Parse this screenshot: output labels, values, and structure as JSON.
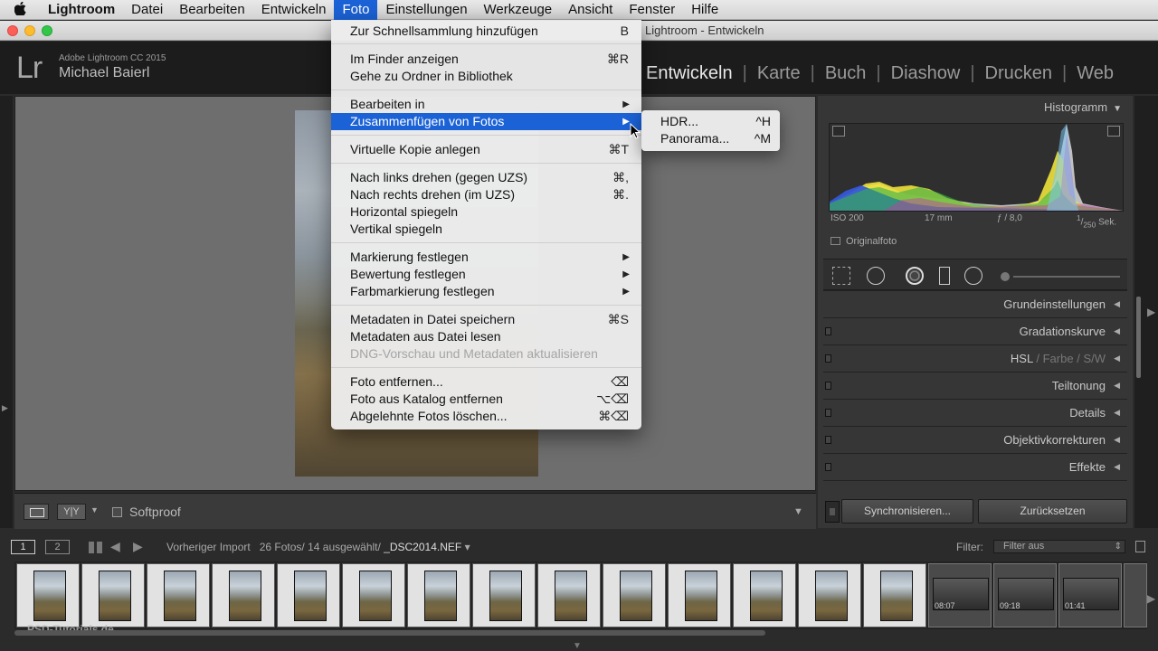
{
  "menubar": {
    "apple": "",
    "items": [
      "Lightroom",
      "Datei",
      "Bearbeiten",
      "Entwickeln",
      "Foto",
      "Einstellungen",
      "Werkzeuge",
      "Ansicht",
      "Fenster",
      "Hilfe"
    ],
    "active": "Foto"
  },
  "window": {
    "title": "Lightroom - Entwickeln"
  },
  "identity": {
    "logo": "Lr",
    "product": "Adobe Lightroom CC 2015",
    "user": "Michael Baierl"
  },
  "modules": {
    "items": [
      "Entwickeln",
      "Karte",
      "Buch",
      "Diashow",
      "Drucken",
      "Web"
    ],
    "active": "Entwickeln"
  },
  "foto_menu": {
    "items": [
      {
        "label": "Zur Schnellsammlung hinzufügen",
        "shortcut": "B"
      },
      {
        "label": "Im Finder anzeigen",
        "shortcut": "⌘R"
      },
      {
        "label": "Gehe zu Ordner in Bibliothek",
        "shortcut": ""
      },
      {
        "label": "Bearbeiten in",
        "submenu": "▶"
      },
      {
        "label": "Zusammenfügen von Fotos",
        "submenu": "▶"
      },
      {
        "label": "Virtuelle Kopie anlegen",
        "shortcut": "⌘T"
      },
      {
        "label": "Nach links drehen (gegen UZS)",
        "shortcut": "⌘,"
      },
      {
        "label": "Nach rechts drehen (im UZS)",
        "shortcut": "⌘."
      },
      {
        "label": "Horizontal spiegeln",
        "shortcut": ""
      },
      {
        "label": "Vertikal spiegeln",
        "shortcut": ""
      },
      {
        "label": "Markierung festlegen",
        "submenu": "▶"
      },
      {
        "label": "Bewertung festlegen",
        "submenu": "▶"
      },
      {
        "label": "Farbmarkierung festlegen",
        "submenu": "▶"
      },
      {
        "label": "Metadaten in Datei speichern",
        "shortcut": "⌘S"
      },
      {
        "label": "Metadaten aus Datei lesen",
        "shortcut": ""
      },
      {
        "label": "DNG-Vorschau und Metadaten aktualisieren",
        "shortcut": ""
      },
      {
        "label": "Foto entfernen...",
        "shortcut": "⌫"
      },
      {
        "label": "Foto aus Katalog entfernen",
        "shortcut": "⌥⌫"
      },
      {
        "label": "Abgelehnte Fotos löschen...",
        "shortcut": "⌘⌫"
      }
    ]
  },
  "merge_submenu": {
    "items": [
      {
        "label": "HDR...",
        "shortcut": "^H"
      },
      {
        "label": "Panorama...",
        "shortcut": "^M"
      }
    ]
  },
  "histogram": {
    "title": "Histogramm",
    "toggle": "▼",
    "iso": "ISO 200",
    "focal": "17 mm",
    "aperture": "ƒ / 8,0",
    "shutter_num": "1",
    "shutter_den": "250",
    "shutter_unit": "Sek.",
    "original_label": "Originalfoto"
  },
  "panels": {
    "grund": "Grundeinstellungen",
    "gradation": "Gradationskurve",
    "hsl": "HSL",
    "hsl_sep1": "/",
    "farbe": "Farbe",
    "hsl_sep2": "/",
    "sw": "S/W",
    "teiltonung": "Teiltonung",
    "details": "Details",
    "objektiv": "Objektivkorrekturen",
    "effekte": "Effekte",
    "toggle": "◀"
  },
  "buttons": {
    "sync": "Synchronisieren...",
    "reset": "Zurücksetzen"
  },
  "toolbar": {
    "yy": "Y|Y",
    "softproof": "Softproof"
  },
  "filmstrip": {
    "page1": "1",
    "page2": "2",
    "source": "Vorheriger Import",
    "count": "26 Fotos/ 14 ausgewählt/",
    "file": "_DSC2014.NEF",
    "file_drop": "▾",
    "filter_label": "Filter:",
    "filter_value": "Filter aus",
    "badges": [
      "08:07",
      "09:18",
      "01:41"
    ]
  },
  "watermark": "PSD-Tutorials.de",
  "colors": {
    "menu_highlight": "#1b62d6",
    "panel_bg": "#363636",
    "workspace": "#6e6e6e"
  }
}
